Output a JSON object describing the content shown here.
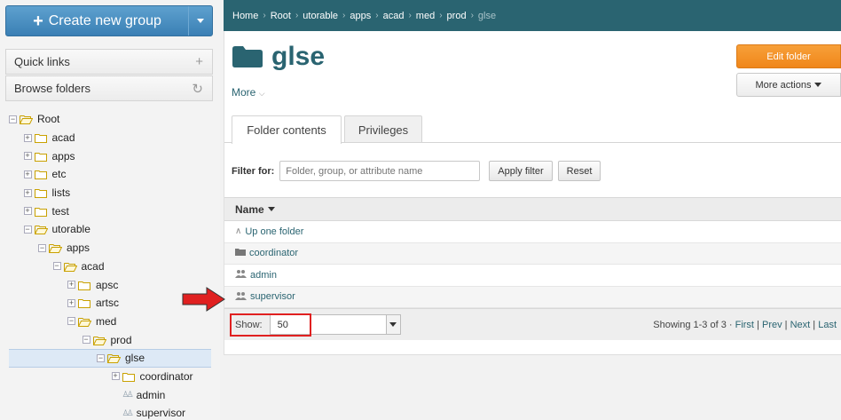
{
  "sidebar": {
    "create_label": "Create new group",
    "quick_links": "Quick links",
    "browse_folders": "Browse folders",
    "tree": [
      {
        "label": "Root",
        "depth": 0,
        "type": "folder-open",
        "expander": "−"
      },
      {
        "label": "acad",
        "depth": 1,
        "type": "folder",
        "expander": "+"
      },
      {
        "label": "apps",
        "depth": 1,
        "type": "folder",
        "expander": "+"
      },
      {
        "label": "etc",
        "depth": 1,
        "type": "folder",
        "expander": "+"
      },
      {
        "label": "lists",
        "depth": 1,
        "type": "folder",
        "expander": "+"
      },
      {
        "label": "test",
        "depth": 1,
        "type": "folder",
        "expander": "+"
      },
      {
        "label": "utorable",
        "depth": 1,
        "type": "folder-open",
        "expander": "−"
      },
      {
        "label": "apps",
        "depth": 2,
        "type": "folder-open",
        "expander": "−"
      },
      {
        "label": "acad",
        "depth": 3,
        "type": "folder-open",
        "expander": "−"
      },
      {
        "label": "apsc",
        "depth": 4,
        "type": "folder",
        "expander": "+"
      },
      {
        "label": "artsc",
        "depth": 4,
        "type": "folder",
        "expander": "+"
      },
      {
        "label": "med",
        "depth": 4,
        "type": "folder-open",
        "expander": "−"
      },
      {
        "label": "prod",
        "depth": 5,
        "type": "folder-open",
        "expander": "−"
      },
      {
        "label": "glse",
        "depth": 6,
        "type": "folder-open",
        "expander": "−",
        "selected": true
      },
      {
        "label": "coordinator",
        "depth": 7,
        "type": "folder",
        "expander": "+"
      },
      {
        "label": "admin",
        "depth": 7,
        "type": "group",
        "expander": ""
      },
      {
        "label": "supervisor",
        "depth": 7,
        "type": "group",
        "expander": ""
      }
    ]
  },
  "breadcrumb": [
    "Home",
    "Root",
    "utorable",
    "apps",
    "acad",
    "med",
    "prod",
    "glse"
  ],
  "folder": {
    "title": "glse",
    "more": "More",
    "edit_label": "Edit folder",
    "more_actions": "More actions"
  },
  "tabs": [
    "Folder contents",
    "Privileges"
  ],
  "filter": {
    "label": "Filter for:",
    "placeholder": "Folder, group, or attribute name",
    "apply": "Apply filter",
    "reset": "Reset"
  },
  "table": {
    "header": "Name",
    "rows": [
      {
        "label": "Up one folder",
        "icon": "up-icon"
      },
      {
        "label": "coordinator",
        "icon": "folder-icon"
      },
      {
        "label": "admin",
        "icon": "group-icon"
      },
      {
        "label": "supervisor",
        "icon": "group-icon"
      }
    ]
  },
  "pager": {
    "show_label": "Show:",
    "show_value": "50",
    "summary": "Showing 1-3 of 3 ·",
    "first": "First",
    "prev": "Prev",
    "next": "Next",
    "last": "Last"
  },
  "colors": {
    "brand": "#2a6471",
    "create_button": "#3a7fb4",
    "edit_button": "#f0861a",
    "highlight": "#e02020"
  }
}
